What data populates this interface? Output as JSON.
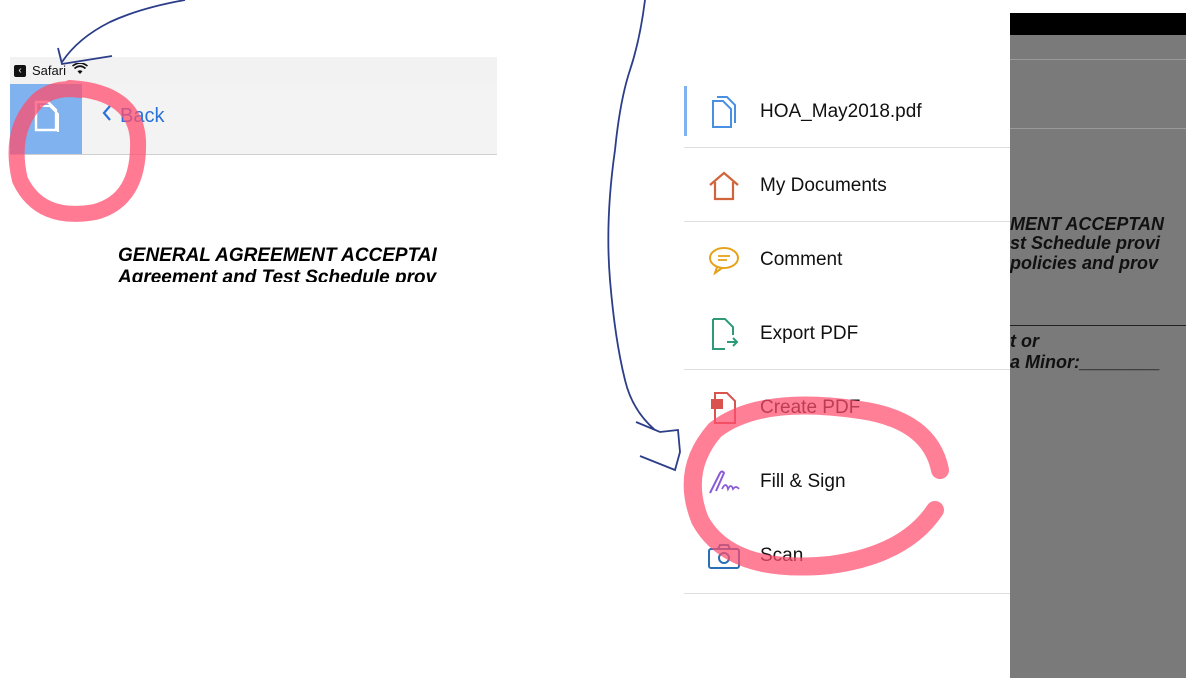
{
  "left": {
    "status_app": "Safari",
    "back_label": "Back",
    "doc_line1": "GENERAL AGREEMENT ACCEPTAI",
    "doc_line2": "Agreement and Test Schedule prov"
  },
  "menu": {
    "items": [
      {
        "label": "HOA_May2018.pdf",
        "icon": "document-icon"
      },
      {
        "label": "My Documents",
        "icon": "home-icon"
      },
      {
        "label": "Comment",
        "icon": "comment-icon"
      },
      {
        "label": "Export PDF",
        "icon": "export-pdf-icon"
      },
      {
        "label": "Create PDF",
        "icon": "create-pdf-icon"
      },
      {
        "label": "Fill & Sign",
        "icon": "fill-sign-icon"
      },
      {
        "label": "Scan",
        "icon": "camera-icon"
      }
    ]
  },
  "doc_preview": {
    "line1": "MENT ACCEPTAN",
    "line2": "st Schedule provi",
    "line3": "policies and prov",
    "line4": "t or",
    "line5": "a Minor:________"
  },
  "colors": {
    "accent": "#2a72d8",
    "tab_highlight": "#7fb2ef",
    "annotation_red": "#ff4d6d",
    "annotation_ink": "#2c3e8a"
  }
}
